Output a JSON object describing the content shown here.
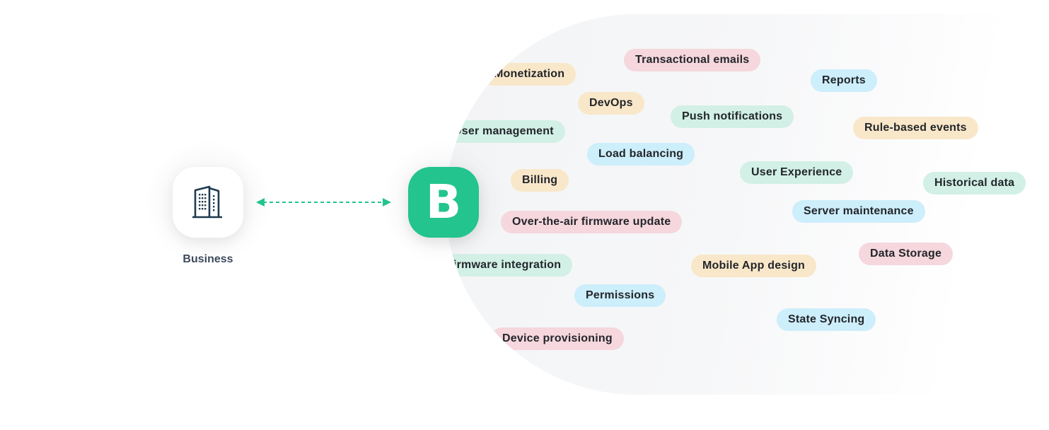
{
  "business": {
    "label": "Business",
    "icon": "building-icon"
  },
  "brand": {
    "letter": "B",
    "color": "#23c48e"
  },
  "connector": {
    "color": "#23c48e",
    "style": "dashed-bidirectional-arrow"
  },
  "tags": [
    {
      "label": "Transactional emails",
      "color": "pink"
    },
    {
      "label": "Monetization",
      "color": "yellow"
    },
    {
      "label": "Reports",
      "color": "blue"
    },
    {
      "label": "DevOps",
      "color": "yellow"
    },
    {
      "label": "Push notifications",
      "color": "green"
    },
    {
      "label": "Rule-based events",
      "color": "yellow"
    },
    {
      "label": "User management",
      "color": "green"
    },
    {
      "label": "Load balancing",
      "color": "blue"
    },
    {
      "label": "User Experience",
      "color": "green"
    },
    {
      "label": "Billing",
      "color": "yellow"
    },
    {
      "label": "Historical data",
      "color": "green"
    },
    {
      "label": "Server maintenance",
      "color": "blue"
    },
    {
      "label": "Over-the-air firmware update",
      "color": "pink"
    },
    {
      "label": "Data Storage",
      "color": "pink"
    },
    {
      "label": "Firmware integration",
      "color": "green"
    },
    {
      "label": "Mobile App design",
      "color": "yellow"
    },
    {
      "label": "Permissions",
      "color": "blue"
    },
    {
      "label": "State Syncing",
      "color": "blue"
    },
    {
      "label": "Device provisioning",
      "color": "pink"
    }
  ],
  "palette": {
    "yellow": "#f9e7c9",
    "pink": "#f5d7dd",
    "green": "#d2f0e5",
    "blue": "#cdeefb"
  }
}
